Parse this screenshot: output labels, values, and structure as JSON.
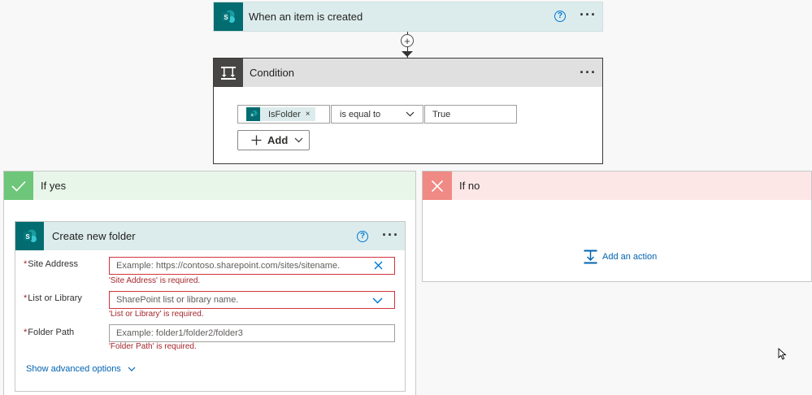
{
  "trigger": {
    "title": "When an item is created",
    "help_icon": "?",
    "more_icon": "···"
  },
  "connector": {
    "plus": "+"
  },
  "condition": {
    "title": "Condition",
    "more_icon": "···",
    "token_label": "IsFolder",
    "token_remove": "×",
    "operator": "is equal to",
    "value": "True",
    "add_label": "Add"
  },
  "if_yes": {
    "title": "If yes"
  },
  "if_no": {
    "title": "If no",
    "add_action_label": "Add an action"
  },
  "create_folder": {
    "title": "Create new folder",
    "help_icon": "?",
    "more_icon": "···",
    "fields": [
      {
        "required_mark": "*",
        "label": "Site Address",
        "placeholder": "Example: https://contoso.sharepoint.com/sites/sitename.",
        "error": "'Site Address' is required."
      },
      {
        "required_mark": "*",
        "label": "List or Library",
        "placeholder": "SharePoint list or library name.",
        "error": "'List or Library' is required."
      },
      {
        "required_mark": "*",
        "label": "Folder Path",
        "placeholder": "Example: folder1/folder2/folder3",
        "error": "'Folder Path' is required."
      }
    ],
    "advanced_link": "Show advanced options"
  },
  "colors": {
    "sharepoint": "#036c70",
    "link": "#0078d4",
    "error": "#a4262c",
    "yes_accent": "#6ec67a",
    "no_accent": "#f08a84"
  }
}
